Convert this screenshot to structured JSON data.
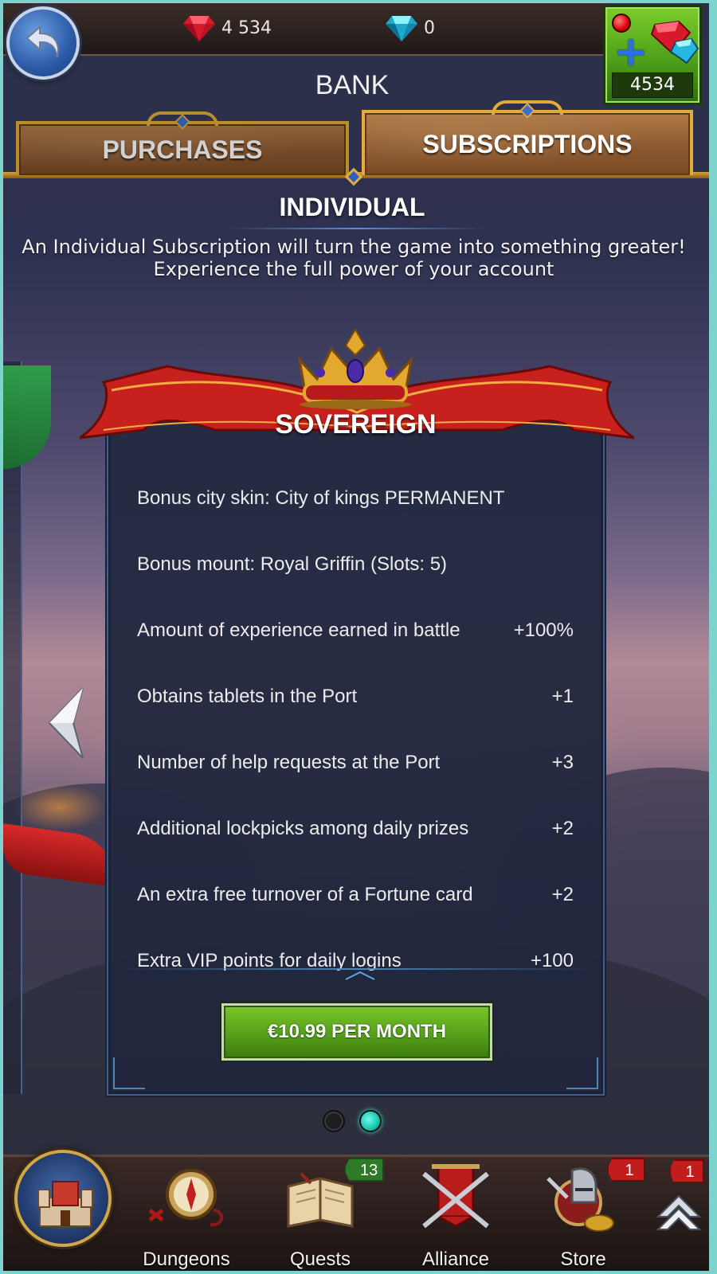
{
  "header": {
    "currencies": [
      {
        "name": "ruby",
        "value": "4 534",
        "color": "#e0283a"
      },
      {
        "name": "sapphire",
        "value": "0",
        "color": "#27b3d6"
      }
    ],
    "shop_count": "4534",
    "title": "BANK"
  },
  "tabs": [
    {
      "label": "PURCHASES",
      "active": false
    },
    {
      "label": "SUBSCRIPTIONS",
      "active": true
    }
  ],
  "section": {
    "title": "INDIVIDUAL",
    "description_line1": "An Individual Subscription will turn the game into something greater!",
    "description_line2": "Experience the full power of your account"
  },
  "card": {
    "tier": "SOVEREIGN",
    "benefits": [
      {
        "label": "Bonus city skin: City of kings PERMANENT",
        "value": ""
      },
      {
        "label": "Bonus mount: Royal Griffin (Slots: 5)",
        "value": ""
      },
      {
        "label": "Amount of experience earned in battle",
        "value": "+100%"
      },
      {
        "label": "Obtains tablets in the Port",
        "value": "+1"
      },
      {
        "label": "Number of help requests at the Port",
        "value": "+3"
      },
      {
        "label": "Additional lockpicks among daily prizes",
        "value": "+2"
      },
      {
        "label": "An extra free turnover of a Fortune card",
        "value": "+2"
      },
      {
        "label": "Extra VIP points for daily logins",
        "value": "+100"
      }
    ],
    "price_button": "€10.99 PER MONTH"
  },
  "pager": {
    "total": 2,
    "active_index": 1
  },
  "bottom_nav": {
    "items": [
      {
        "label": "Dungeons",
        "icon": "compass-icon"
      },
      {
        "label": "Quests",
        "icon": "book-icon",
        "badge": "13"
      },
      {
        "label": "Alliance",
        "icon": "banner-icon"
      },
      {
        "label": "Store",
        "icon": "knight-helmet-icon",
        "badge": "1"
      }
    ],
    "more_badge": "1"
  },
  "colors": {
    "accent_gold": "#e3ac38",
    "buy_green": "#55a01a",
    "pager_active": "#16c6b0"
  }
}
